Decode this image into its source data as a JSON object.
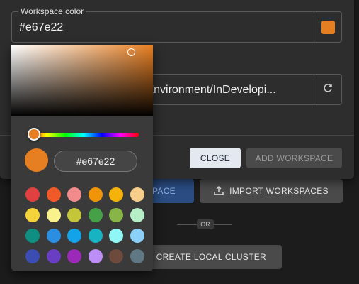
{
  "background": {
    "add_label": "PACE",
    "import_label": "IMPORT WORKSPACES",
    "or_label": "OR",
    "local_cluster_label": "CREATE LOCAL CLUSTER"
  },
  "dialog": {
    "color_field": {
      "label": "Workspace color",
      "value": "#e67e22",
      "swatch_color": "#e67e22"
    },
    "path_field": {
      "value": "/Environment/InDevelopi..."
    },
    "close_label": "CLOSE",
    "add_workspace_label": "ADD WORKSPACE"
  },
  "picker": {
    "hex_value": "#e67e22",
    "current_color": "#e67e22",
    "swatches": [
      "#e04040",
      "#f05a28",
      "#f28b8b",
      "#f0940a",
      "#f5b20a",
      "#f8cf8a",
      "#f5d33a",
      "#f9f28c",
      "#c5c53a",
      "#45a048",
      "#88b548",
      "#b6eec8",
      "#0f8f82",
      "#2a8ee2",
      "#12a3e8",
      "#17b3c2",
      "#8ff8f6",
      "#8ad0f8",
      "#3b4cb3",
      "#6a3ec2",
      "#9c2ab8",
      "#bd8ef5",
      "#6e4a3c",
      "#5f7884"
    ]
  }
}
